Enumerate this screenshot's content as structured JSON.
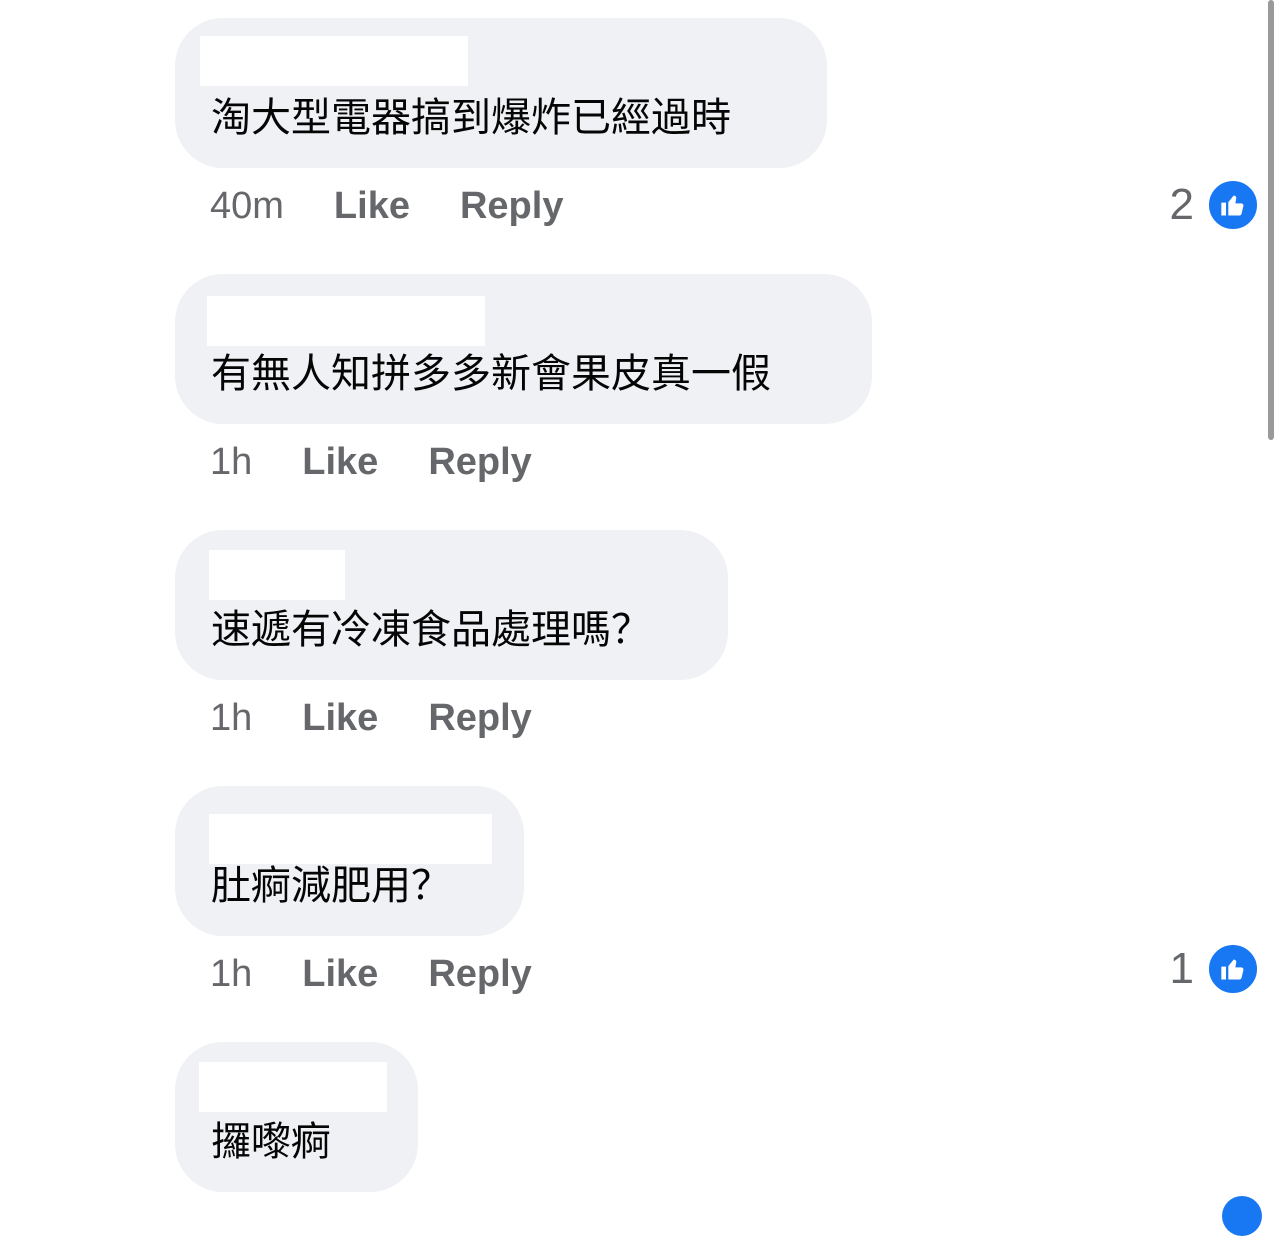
{
  "comments": [
    {
      "text": "淘大型電器搞到爆炸已經過時",
      "time": "40m",
      "like": "Like",
      "reply": "Reply",
      "reactions": "2"
    },
    {
      "text": "有無人知拼多多新會果皮真一假",
      "time": "1h",
      "like": "Like",
      "reply": "Reply",
      "reactions": ""
    },
    {
      "text": "速遞有冷凍食品處理嗎？",
      "time": "1h",
      "like": "Like",
      "reply": "Reply",
      "reactions": ""
    },
    {
      "text": "肚痾減肥用？",
      "time": "1h",
      "like": "Like",
      "reply": "Reply",
      "reactions": "1"
    },
    {
      "text": "攞嚟痾",
      "time": "",
      "like": "",
      "reply": "",
      "reactions": ""
    }
  ],
  "icons": {
    "reaction": "thumbs-up-icon"
  },
  "colors": {
    "bubble": "#f0f1f4",
    "meta": "#65676b",
    "like_blue": "#1877f2"
  }
}
